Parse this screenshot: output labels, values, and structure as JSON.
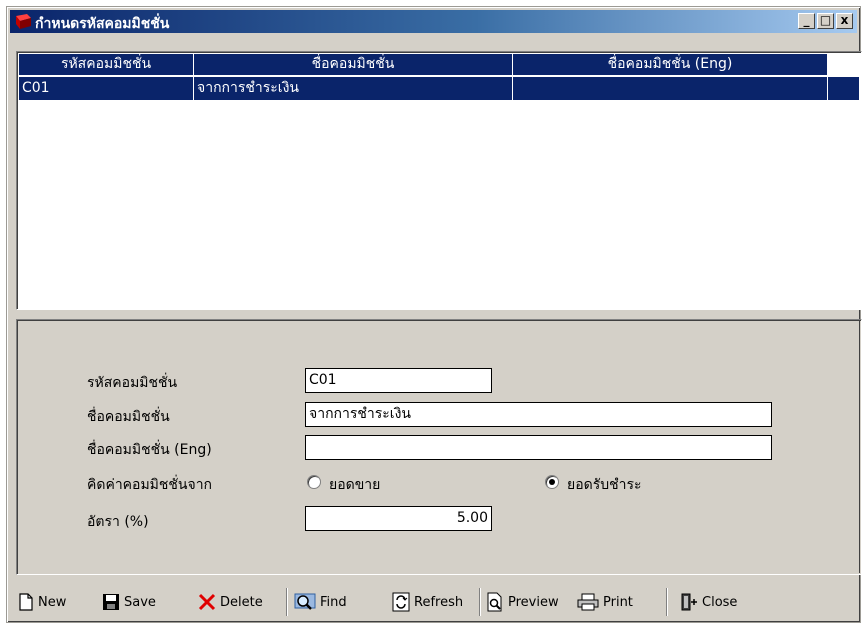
{
  "window": {
    "title": "กำหนดรหัสคอมมิชชั่น",
    "controls": {
      "minimize": "_",
      "maximize": "□",
      "close": "x"
    }
  },
  "grid": {
    "columns": [
      "รหัสคอมมิชชั่น",
      "ชื่อคอมมิชชั่น",
      "ชื่อคอมมิชชั่น (Eng)"
    ],
    "rows": [
      {
        "code": "C01",
        "name": "จากการชำระเงิน",
        "name_eng": ""
      }
    ]
  },
  "form": {
    "code_label": "รหัสคอมมิชชั่น",
    "code_value": "C01",
    "name_label": "ชื่อคอมมิชชั่น",
    "name_value": "จากการชำระเงิน",
    "name_eng_label": "ชื่อคอมมิชชั่น (Eng)",
    "name_eng_value": "",
    "calc_label": "คิดค่าคอมมิชชั่นจาก",
    "option_sales": "ยอดขาย",
    "option_payment": "ยอดรับชำระ",
    "selected_option": "ยอดรับชำระ",
    "rate_label": "อัตรา (%)",
    "rate_value": "5.00"
  },
  "toolbar": {
    "new": "New",
    "save": "Save",
    "delete": "Delete",
    "find": "Find",
    "refresh": "Refresh",
    "preview": "Preview",
    "print": "Print",
    "close": "Close"
  },
  "colors": {
    "selection": "#0a246a",
    "face": "#d4d0c8",
    "delete_icon": "#e00000"
  }
}
